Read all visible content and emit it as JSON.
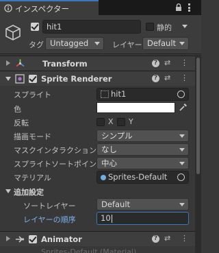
{
  "tab": {
    "title": "インスペクター",
    "lock_icon": "lock-icon",
    "menu_icon": "kebab-icon"
  },
  "header": {
    "object_name": "hit1",
    "static_label": "静的",
    "tag_label": "タグ",
    "tag_value": "Untagged",
    "layer_label": "レイヤー",
    "layer_value": "Default"
  },
  "transform": {
    "title": "Transform"
  },
  "sprite_renderer": {
    "title": "Sprite Renderer",
    "fields": {
      "sprite": {
        "label": "スプライト",
        "value": "hit1"
      },
      "color": {
        "label": "色",
        "value": "#ffffff"
      },
      "flip": {
        "label": "反転",
        "x": "X",
        "y": "Y"
      },
      "draw_mode": {
        "label": "描画モード",
        "value": "シンプル"
      },
      "mask": {
        "label": "マスクインタラクション",
        "value": "なし"
      },
      "pivot": {
        "label": "スプライトソートポイント",
        "value": "中心"
      },
      "material": {
        "label": "マテリアル",
        "value": "Sprites-Default"
      }
    },
    "additional": {
      "label": "追加設定",
      "sorting_layer": {
        "label": "ソートレイヤー",
        "value": "Default"
      },
      "order": {
        "label": "レイヤーの順序",
        "value": "10"
      }
    }
  },
  "animator": {
    "title": "Animator",
    "footer_text": "Sprites-Default (Material)"
  }
}
